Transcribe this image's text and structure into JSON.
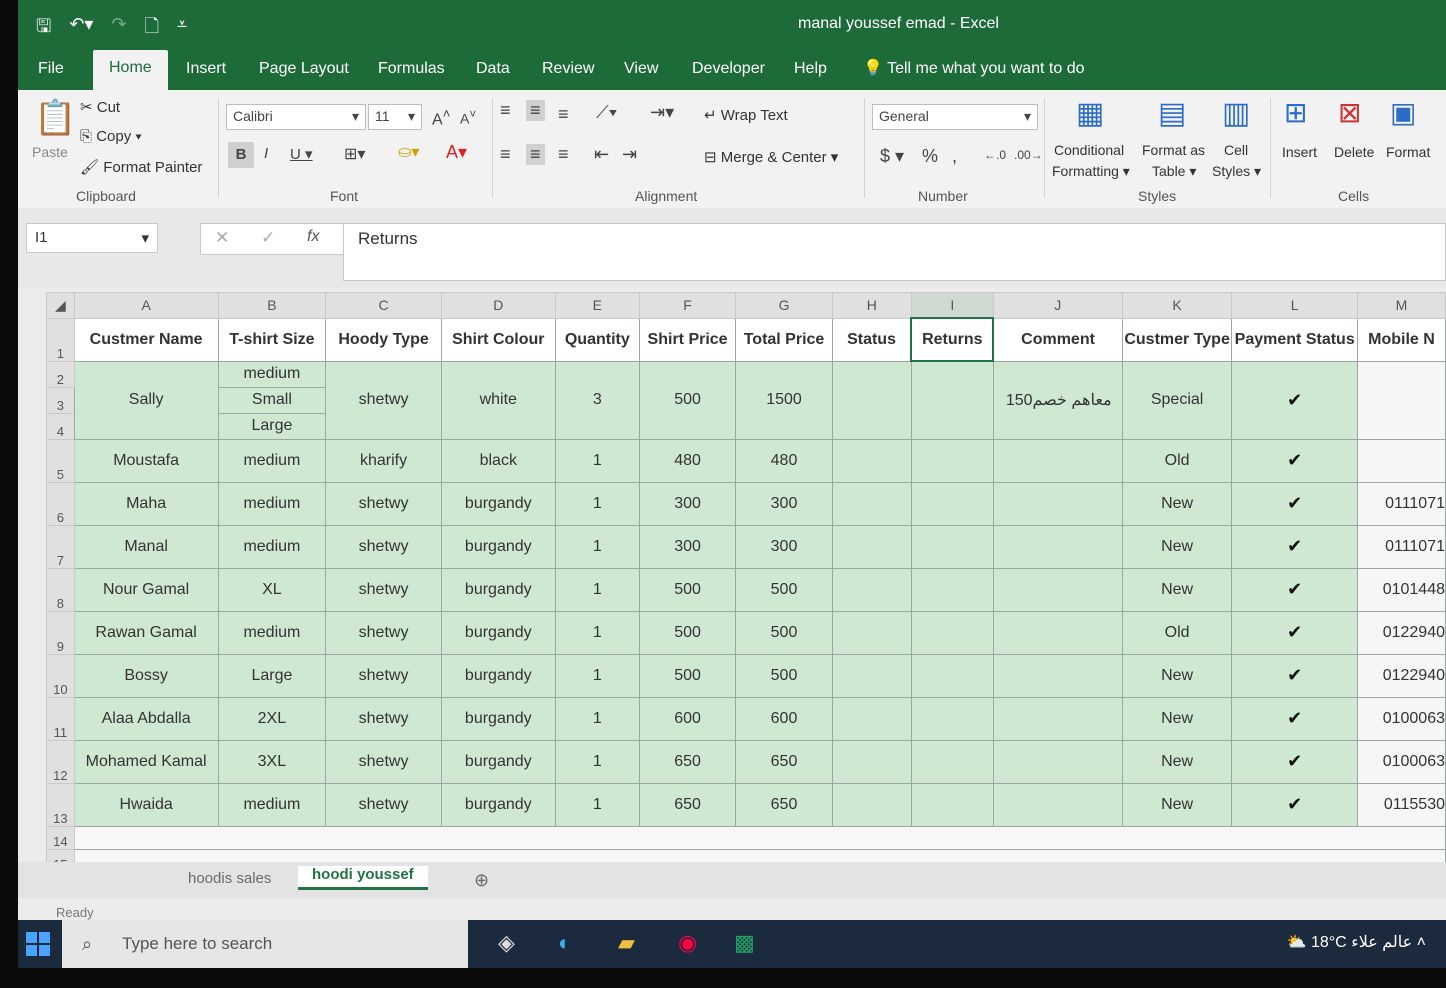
{
  "window": {
    "title": "manal youssef emad  -  Excel"
  },
  "menu": {
    "tabs": [
      "File",
      "Home",
      "Insert",
      "Page Layout",
      "Formulas",
      "Data",
      "Review",
      "View",
      "Developer",
      "Help"
    ],
    "active": "Home",
    "tell_me": "Tell me what you want to do"
  },
  "ribbon": {
    "clipboard": {
      "paste": "Paste",
      "cut": "Cut",
      "copy": "Copy",
      "format_painter": "Format Painter",
      "label": "Clipboard"
    },
    "font": {
      "name": "Calibri",
      "size": "11",
      "label": "Font"
    },
    "alignment": {
      "wrap": "Wrap Text",
      "merge": "Merge & Center",
      "label": "Alignment"
    },
    "number": {
      "format": "General",
      "label": "Number"
    },
    "styles": {
      "conditional": "Conditional",
      "conditional2": "Formatting",
      "format_as": "Format as",
      "format_as2": "Table",
      "cell": "Cell",
      "cell2": "Styles",
      "label": "Styles"
    },
    "cells": {
      "insert": "Insert",
      "delete": "Delete",
      "format": "Format",
      "label": "Cells"
    }
  },
  "formula_bar": {
    "name_box": "I1",
    "fx": "fx",
    "value": "Returns"
  },
  "columns": [
    "A",
    "B",
    "C",
    "D",
    "E",
    "F",
    "G",
    "H",
    "I",
    "J",
    "K",
    "L",
    "M"
  ],
  "headers": [
    "Custmer Name",
    "T-shirt Size",
    "Hoody Type",
    "Shirt Colour",
    "Quantity",
    "Shirt Price",
    "Total Price",
    "Status",
    "Returns",
    "Comment",
    "Custmer Type",
    "Payment Status",
    "Mobile N"
  ],
  "sally": {
    "name": "Sally",
    "sizes": [
      "medium",
      "Small",
      "Large"
    ],
    "type": "shetwy",
    "colour": "white",
    "qty": "3",
    "price": "500",
    "total": "1500",
    "comment": "150معاهم خصم",
    "ctype": "Special",
    "paid": "✔"
  },
  "rows": [
    {
      "row": "5",
      "name": "Moustafa",
      "size": "medium",
      "type": "kharify",
      "colour": "black",
      "qty": "1",
      "price": "480",
      "total": "480",
      "ctype": "Old",
      "paid": "✔",
      "mobile": ""
    },
    {
      "row": "6",
      "name": "Maha",
      "size": "medium",
      "type": "shetwy",
      "colour": "burgandy",
      "qty": "1",
      "price": "300",
      "total": "300",
      "ctype": "New",
      "paid": "✔",
      "mobile": "0111071"
    },
    {
      "row": "7",
      "name": "Manal",
      "size": "medium",
      "type": "shetwy",
      "colour": "burgandy",
      "qty": "1",
      "price": "300",
      "total": "300",
      "ctype": "New",
      "paid": "✔",
      "mobile": "0111071"
    },
    {
      "row": "8",
      "name": "Nour Gamal",
      "size": "XL",
      "type": "shetwy",
      "colour": "burgandy",
      "qty": "1",
      "price": "500",
      "total": "500",
      "ctype": "New",
      "paid": "✔",
      "mobile": "0101448"
    },
    {
      "row": "9",
      "name": "Rawan Gamal",
      "size": "medium",
      "type": "shetwy",
      "colour": "burgandy",
      "qty": "1",
      "price": "500",
      "total": "500",
      "ctype": "Old",
      "paid": "✔",
      "mobile": "0122940"
    },
    {
      "row": "10",
      "name": "Bossy",
      "size": "Large",
      "type": "shetwy",
      "colour": "burgandy",
      "qty": "1",
      "price": "500",
      "total": "500",
      "ctype": "New",
      "paid": "✔",
      "mobile": "0122940"
    },
    {
      "row": "11",
      "name": "Alaa Abdalla",
      "size": "2XL",
      "type": "shetwy",
      "colour": "burgandy",
      "qty": "1",
      "price": "600",
      "total": "600",
      "ctype": "New",
      "paid": "✔",
      "mobile": "0100063"
    },
    {
      "row": "12",
      "name": "Mohamed Kamal",
      "size": "3XL",
      "type": "shetwy",
      "colour": "burgandy",
      "qty": "1",
      "price": "650",
      "total": "650",
      "ctype": "New",
      "paid": "✔",
      "mobile": "0100063"
    },
    {
      "row": "13",
      "name": "Hwaida",
      "size": "medium",
      "type": "shetwy",
      "colour": "burgandy",
      "qty": "1",
      "price": "650",
      "total": "650",
      "ctype": "New",
      "paid": "✔",
      "mobile": "0115530"
    }
  ],
  "row_numbers": {
    "r1": "1",
    "r2": "2",
    "r3": "3",
    "r4": "4",
    "r14": "14",
    "r15": "15"
  },
  "sheets": [
    "hoodis sales",
    "hoodi youssef"
  ],
  "active_sheet": "hoodi youssef",
  "status": "Ready",
  "taskbar": {
    "search": "Type here to search",
    "weather": "18°C  عالم علاء"
  },
  "colors": {
    "excel_green": "#1e6b3a",
    "fill": "#cfe8d2"
  }
}
